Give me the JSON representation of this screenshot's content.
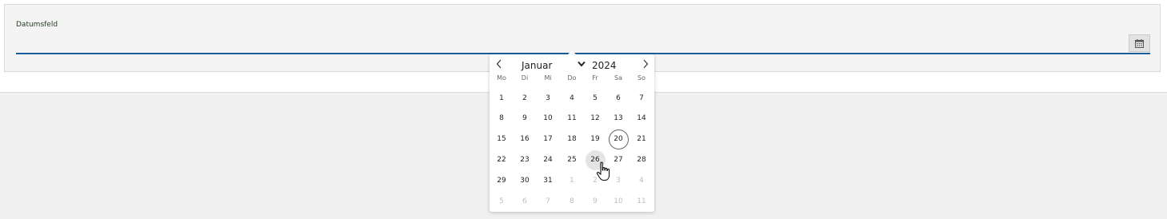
{
  "field": {
    "label": "Datumsfeld",
    "value": "",
    "placeholder": "",
    "button_icon": "calendar-icon"
  },
  "datepicker": {
    "prev_icon": "chevron-left-icon",
    "next_icon": "chevron-right-icon",
    "month": "Januar",
    "year": "2024",
    "weekdays": [
      "Mo",
      "Di",
      "Mi",
      "Do",
      "Fr",
      "Sa",
      "So"
    ],
    "weeks": [
      [
        {
          "d": "1"
        },
        {
          "d": "2"
        },
        {
          "d": "3"
        },
        {
          "d": "4"
        },
        {
          "d": "5"
        },
        {
          "d": "6"
        },
        {
          "d": "7"
        }
      ],
      [
        {
          "d": "8"
        },
        {
          "d": "9"
        },
        {
          "d": "10"
        },
        {
          "d": "11"
        },
        {
          "d": "12"
        },
        {
          "d": "13"
        },
        {
          "d": "14"
        }
      ],
      [
        {
          "d": "15"
        },
        {
          "d": "16"
        },
        {
          "d": "17"
        },
        {
          "d": "18"
        },
        {
          "d": "19"
        },
        {
          "d": "20",
          "today": true
        },
        {
          "d": "21"
        }
      ],
      [
        {
          "d": "22"
        },
        {
          "d": "23"
        },
        {
          "d": "24"
        },
        {
          "d": "25"
        },
        {
          "d": "26",
          "hover": true
        },
        {
          "d": "27"
        },
        {
          "d": "28"
        }
      ],
      [
        {
          "d": "29"
        },
        {
          "d": "30"
        },
        {
          "d": "31"
        },
        {
          "d": "1",
          "other": true
        },
        {
          "d": "2",
          "other": true
        },
        {
          "d": "3",
          "other": true
        },
        {
          "d": "4",
          "other": true
        }
      ],
      [
        {
          "d": "5",
          "other": true
        },
        {
          "d": "6",
          "other": true
        },
        {
          "d": "7",
          "other": true
        },
        {
          "d": "8",
          "other": true
        },
        {
          "d": "9",
          "other": true
        },
        {
          "d": "10",
          "other": true
        },
        {
          "d": "11",
          "other": true
        }
      ]
    ]
  },
  "cursor_icon": "hand-pointer-icon",
  "colors": {
    "accent": "#1a5d9a",
    "label": "#1e3c1e",
    "today_ring": "#666666",
    "hover_bg": "#e4e4e4",
    "other_month": "#bdbdbd"
  }
}
